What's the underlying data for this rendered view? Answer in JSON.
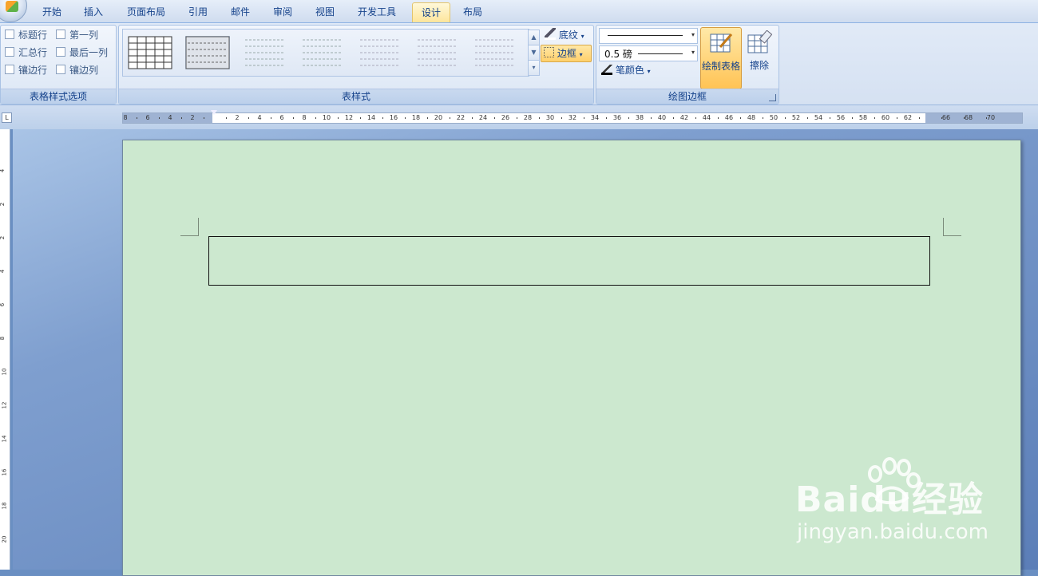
{
  "tabs": [
    "开始",
    "插入",
    "页面布局",
    "引用",
    "邮件",
    "审阅",
    "视图",
    "开发工具",
    "设计",
    "布局"
  ],
  "active_tab": "设计",
  "ribbon": {
    "table_style_options": {
      "label": "表格样式选项",
      "checkboxes": [
        "标题行",
        "第一列",
        "汇总行",
        "最后一列",
        "镶边行",
        "镶边列"
      ]
    },
    "table_styles": {
      "label": "表样式",
      "shading": "底纹",
      "borders": "边框"
    },
    "draw_borders": {
      "label": "绘图边框",
      "pen_weight": "0.5 磅",
      "pen_color": "笔颜色",
      "draw_table": "绘制表格",
      "eraser": "擦除"
    }
  },
  "ruler": {
    "left_numbers": [
      "8",
      "6",
      "4",
      "2"
    ],
    "right_numbers": [
      "2",
      "4",
      "6",
      "8",
      "10",
      "12",
      "14",
      "16",
      "18",
      "20",
      "22",
      "24",
      "26",
      "28",
      "30",
      "32",
      "34",
      "36",
      "38",
      "40",
      "42",
      "44",
      "46",
      "48",
      "50",
      "52",
      "54",
      "56",
      "58",
      "60",
      "62"
    ],
    "far_numbers": [
      "66",
      "68",
      "70"
    ],
    "vertical_numbers": [
      "4",
      "2",
      "2",
      "4",
      "6",
      "8",
      "10",
      "12",
      "14",
      "16",
      "18",
      "20"
    ]
  },
  "watermark": {
    "brand": "Baidu经验",
    "url": "jingyan.baidu.com"
  },
  "colors": {
    "page": "#cce8cf",
    "active_tab": "#fde59b",
    "ribbon": "#dbe6f5"
  }
}
